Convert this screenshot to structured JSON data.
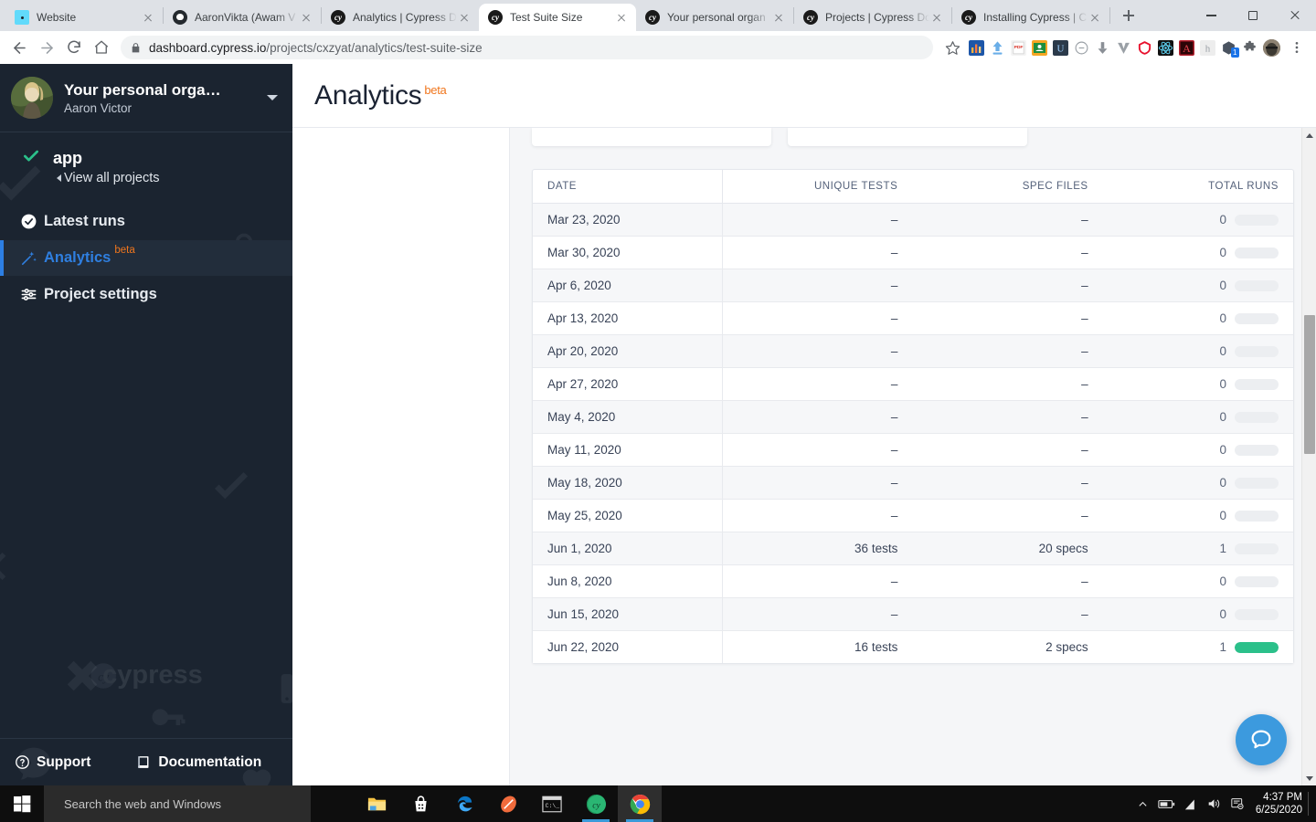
{
  "browser": {
    "tabs": [
      {
        "title": "Website",
        "favicon": "react-icon",
        "active": false
      },
      {
        "title": "AaronVikta (Awam V",
        "favicon": "github-icon",
        "active": false
      },
      {
        "title": "Analytics | Cypress D",
        "favicon": "cypress-icon",
        "active": false
      },
      {
        "title": "Test Suite Size",
        "favicon": "cypress-icon",
        "active": true
      },
      {
        "title": "Your personal organ",
        "favicon": "cypress-icon",
        "active": false
      },
      {
        "title": "Projects | Cypress Do",
        "favicon": "cypress-icon",
        "active": false
      },
      {
        "title": "Installing Cypress | C",
        "favicon": "cypress-icon",
        "active": false
      }
    ],
    "new_tab_label": "+",
    "url_domain": "dashboard.cypress.io",
    "url_path": "/projects/cxzyat/analytics/test-suite-size",
    "extension_badge": "1",
    "window_controls": {
      "minimize": "minimize-icon",
      "maximize": "maximize-icon",
      "close": "close-icon"
    }
  },
  "sidebar": {
    "org_name": "Your personal orga…",
    "user_name": "Aaron Victor",
    "project_name": "app",
    "view_all_projects": "View all projects",
    "nav": [
      {
        "label": "Latest runs",
        "icon": "check-circle-icon",
        "active": false,
        "badge": ""
      },
      {
        "label": "Analytics",
        "icon": "magic-wand-icon",
        "active": true,
        "badge": "beta"
      },
      {
        "label": "Project settings",
        "icon": "sliders-icon",
        "active": false,
        "badge": ""
      }
    ],
    "watermark": "cypress",
    "footer": [
      {
        "label": "Support",
        "icon": "question-circle-icon"
      },
      {
        "label": "Documentation",
        "icon": "book-icon"
      }
    ],
    "accent_active": "#2d7fe4",
    "beta_color": "#f0761d"
  },
  "page": {
    "title": "Analytics",
    "title_badge": "beta"
  },
  "chart_data": {
    "type": "table",
    "title": "Test Suite Size",
    "columns": [
      "DATE",
      "UNIQUE TESTS",
      "SPEC FILES",
      "TOTAL RUNS"
    ],
    "rows": [
      {
        "date": "Mar 23, 2020",
        "unique_tests": "–",
        "spec_files": "–",
        "total_runs": "0",
        "bar_pct": 0
      },
      {
        "date": "Mar 30, 2020",
        "unique_tests": "–",
        "spec_files": "–",
        "total_runs": "0",
        "bar_pct": 0
      },
      {
        "date": "Apr 6, 2020",
        "unique_tests": "–",
        "spec_files": "–",
        "total_runs": "0",
        "bar_pct": 0
      },
      {
        "date": "Apr 13, 2020",
        "unique_tests": "–",
        "spec_files": "–",
        "total_runs": "0",
        "bar_pct": 0
      },
      {
        "date": "Apr 20, 2020",
        "unique_tests": "–",
        "spec_files": "–",
        "total_runs": "0",
        "bar_pct": 0
      },
      {
        "date": "Apr 27, 2020",
        "unique_tests": "–",
        "spec_files": "–",
        "total_runs": "0",
        "bar_pct": 0
      },
      {
        "date": "May 4, 2020",
        "unique_tests": "–",
        "spec_files": "–",
        "total_runs": "0",
        "bar_pct": 0
      },
      {
        "date": "May 11, 2020",
        "unique_tests": "–",
        "spec_files": "–",
        "total_runs": "0",
        "bar_pct": 0
      },
      {
        "date": "May 18, 2020",
        "unique_tests": "–",
        "spec_files": "–",
        "total_runs": "0",
        "bar_pct": 0
      },
      {
        "date": "May 25, 2020",
        "unique_tests": "–",
        "spec_files": "–",
        "total_runs": "0",
        "bar_pct": 0
      },
      {
        "date": "Jun 1, 2020",
        "unique_tests": "36 tests",
        "spec_files": "20 specs",
        "total_runs": "1",
        "bar_pct": 0
      },
      {
        "date": "Jun 8, 2020",
        "unique_tests": "–",
        "spec_files": "–",
        "total_runs": "0",
        "bar_pct": 0
      },
      {
        "date": "Jun 15, 2020",
        "unique_tests": "–",
        "spec_files": "–",
        "total_runs": "0",
        "bar_pct": 0
      },
      {
        "date": "Jun 22, 2020",
        "unique_tests": "16 tests",
        "spec_files": "2 specs",
        "total_runs": "1",
        "bar_pct": 100
      }
    ],
    "bar_color": "#2bc08a",
    "bar_track_color": "#eceef1",
    "xlabel": "",
    "ylabel": "",
    "legend": []
  },
  "help_widget": {
    "icon": "chat-bubble-icon",
    "color": "#3c9ade"
  },
  "taskbar": {
    "start": "windows-logo-icon",
    "search_placeholder": "Search the web and Windows",
    "apps": [
      {
        "name": "file-explorer-icon"
      },
      {
        "name": "store-icon"
      },
      {
        "name": "edge-icon"
      },
      {
        "name": "paint-icon"
      },
      {
        "name": "command-prompt-icon"
      },
      {
        "name": "cypress-app-icon"
      },
      {
        "name": "chrome-icon"
      }
    ],
    "time": "4:37 PM",
    "date": "6/25/2020"
  }
}
